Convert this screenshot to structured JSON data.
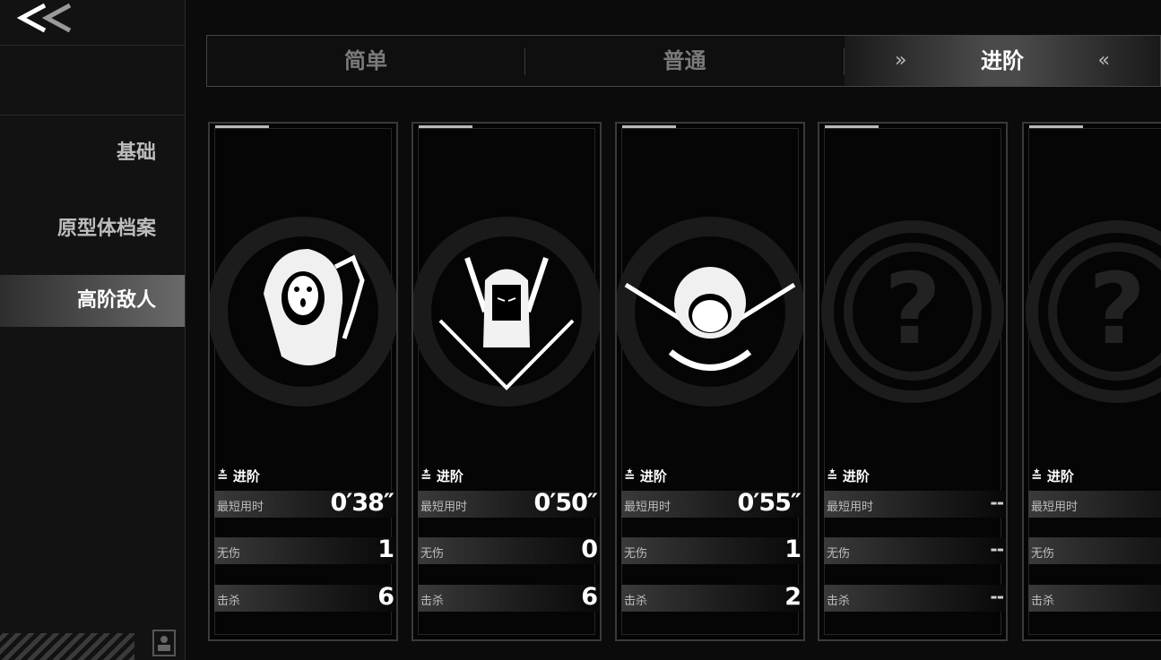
{
  "sidebar": {
    "back_icon": "double-chevron-left-icon",
    "items": [
      {
        "label": "基础"
      },
      {
        "label": "原型体档案"
      },
      {
        "label": "高阶敌人",
        "active": true
      }
    ]
  },
  "tabs": [
    {
      "label": "简单"
    },
    {
      "label": "普通"
    },
    {
      "label": "进阶",
      "active": true
    }
  ],
  "cards": [
    {
      "difficulty": "进阶",
      "emblem": "hooded-masked-enemy-emblem",
      "stats": [
        {
          "label": "最短用时",
          "value": "0′38″"
        },
        {
          "label": "无伤",
          "value": "1"
        },
        {
          "label": "击杀",
          "value": "6"
        }
      ]
    },
    {
      "difficulty": "进阶",
      "emblem": "horned-long-hair-enemy-emblem",
      "stats": [
        {
          "label": "最短用时",
          "value": "0′50″"
        },
        {
          "label": "无伤",
          "value": "0"
        },
        {
          "label": "击杀",
          "value": "6"
        }
      ]
    },
    {
      "difficulty": "进阶",
      "emblem": "crossed-swords-bob-hair-enemy-emblem",
      "stats": [
        {
          "label": "最短用时",
          "value": "0′55″"
        },
        {
          "label": "无伤",
          "value": "1"
        },
        {
          "label": "击杀",
          "value": "2"
        }
      ]
    },
    {
      "difficulty": "进阶",
      "emblem": "locked-question-mark-emblem",
      "stats": [
        {
          "label": "最短用时",
          "value": "--"
        },
        {
          "label": "无伤",
          "value": "--"
        },
        {
          "label": "击杀",
          "value": "--"
        }
      ]
    },
    {
      "difficulty": "进阶",
      "emblem": "locked-question-mark-emblem",
      "stats": [
        {
          "label": "最短用时",
          "value": ""
        },
        {
          "label": "无伤",
          "value": ""
        },
        {
          "label": "击杀",
          "value": ""
        }
      ]
    }
  ]
}
